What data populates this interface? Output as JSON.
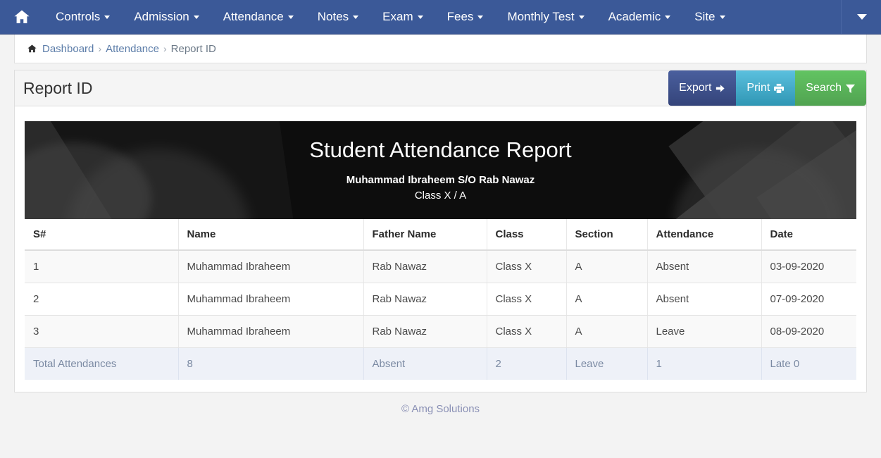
{
  "navbar": {
    "home_icon": "home-icon",
    "items": [
      {
        "label": "Controls",
        "has_caret": true
      },
      {
        "label": "Admission",
        "has_caret": true
      },
      {
        "label": "Attendance",
        "has_caret": true
      },
      {
        "label": "Notes",
        "has_caret": true
      },
      {
        "label": "Exam",
        "has_caret": true
      },
      {
        "label": "Fees",
        "has_caret": true
      },
      {
        "label": "Monthly Test",
        "has_caret": true
      },
      {
        "label": "Academic",
        "has_caret": true
      },
      {
        "label": "Site",
        "has_caret": true
      }
    ],
    "right_toggle_icon": "chevron-down-icon",
    "background_color": "#3b5998"
  },
  "breadcrumb": {
    "home_icon": "home-icon",
    "items": [
      {
        "label": "Dashboard",
        "active": false
      },
      {
        "label": "Attendance",
        "active": false
      },
      {
        "label": "Report ID",
        "active": true
      }
    ],
    "separator": "›"
  },
  "panel": {
    "title": "Report ID",
    "buttons": [
      {
        "label": "Export",
        "icon": "arrow-right-icon",
        "color": "#3c4f8c"
      },
      {
        "label": "Print",
        "icon": "printer-icon",
        "color": "#38b0d3"
      },
      {
        "label": "Search",
        "icon": "filter-icon",
        "color": "#58b558"
      }
    ]
  },
  "report": {
    "title": "Student Attendance Report",
    "subtitle_line1": "Muhammad Ibraheem S/O Rab Nawaz",
    "subtitle_line2": "Class X / A",
    "columns": [
      "S#",
      "Name",
      "Father Name",
      "Class",
      "Section",
      "Attendance",
      "Date"
    ],
    "rows": [
      [
        "1",
        "Muhammad Ibraheem",
        "Rab Nawaz",
        "Class X",
        "A",
        "Absent",
        "03-09-2020"
      ],
      [
        "2",
        "Muhammad Ibraheem",
        "Rab Nawaz",
        "Class X",
        "A",
        "Absent",
        "07-09-2020"
      ],
      [
        "3",
        "Muhammad Ibraheem",
        "Rab Nawaz",
        "Class X",
        "A",
        "Leave",
        "08-09-2020"
      ]
    ],
    "totals": [
      "Total Attendances",
      "8",
      "Absent",
      "2",
      "Leave",
      "1",
      "Late 0"
    ]
  },
  "footer": {
    "text": "© Amg Solutions"
  }
}
